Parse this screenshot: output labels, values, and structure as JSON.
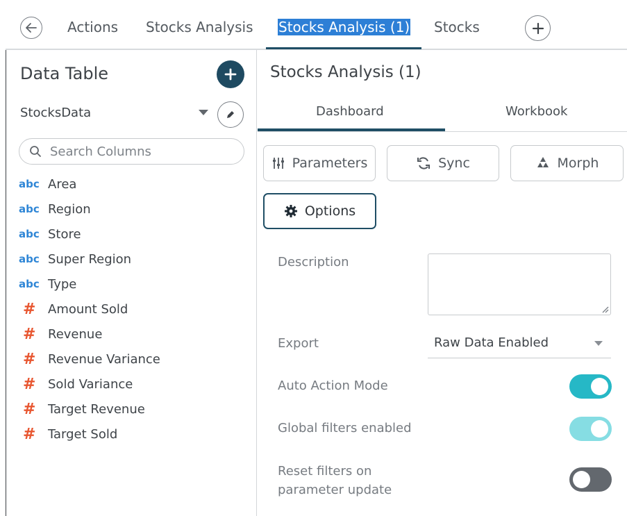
{
  "tabs": [
    {
      "label": "Actions"
    },
    {
      "label": "Stocks Analysis"
    },
    {
      "label": "Stocks Analysis (1)"
    },
    {
      "label": "Stocks"
    }
  ],
  "data_table": {
    "title": "Data Table",
    "data_source": "StocksData",
    "search_placeholder": "Search Columns",
    "columns": [
      {
        "type": "abc",
        "name": "Area"
      },
      {
        "type": "abc",
        "name": "Region"
      },
      {
        "type": "abc",
        "name": "Store"
      },
      {
        "type": "abc",
        "name": "Super Region"
      },
      {
        "type": "abc",
        "name": "Type"
      },
      {
        "type": "#",
        "name": "Amount Sold"
      },
      {
        "type": "#",
        "name": "Revenue"
      },
      {
        "type": "#",
        "name": "Revenue Variance"
      },
      {
        "type": "#",
        "name": "Sold Variance"
      },
      {
        "type": "#",
        "name": "Target Revenue"
      },
      {
        "type": "#",
        "name": "Target Sold"
      }
    ]
  },
  "panel": {
    "title": "Stocks Analysis (1)",
    "subtabs": [
      "Dashboard",
      "Workbook"
    ],
    "buttons": {
      "parameters": "Parameters",
      "sync": "Sync",
      "morph": "Morph",
      "options": "Options"
    },
    "fields": {
      "description_label": "Description",
      "description_value": "",
      "export_label": "Export",
      "export_value": "Raw Data Enabled",
      "auto_action_label": "Auto Action Mode",
      "auto_action_on": true,
      "global_filters_label": "Global filters enabled",
      "global_filters_on": true,
      "reset_filters_label_1": "Reset filters on",
      "reset_filters_label_2": "parameter update",
      "reset_filters_on": false
    }
  },
  "colors": {
    "accent_dark": "#1e4a61",
    "active_tab_highlight": "#2d7fd6",
    "abc_type": "#2f86d6",
    "numeric_type": "#e85630",
    "toggle_on": "#26b8c6",
    "toggle_on_light": "#86dde3",
    "toggle_off": "#63686e"
  }
}
